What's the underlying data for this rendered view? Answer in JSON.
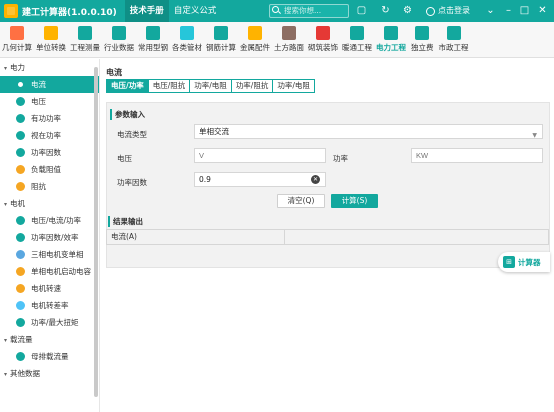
{
  "app": {
    "title": "建工计算器(1.0.0.10)"
  },
  "title_tabs": [
    {
      "label": "技术手册",
      "active": true
    },
    {
      "label": "自定义公式",
      "active": false
    }
  ],
  "search": {
    "placeholder": "搜索你想..."
  },
  "login": {
    "label": "点击登录"
  },
  "window_icons": [
    "dropdown-icon",
    "minimize-icon",
    "maximize-icon",
    "close-icon"
  ],
  "toolbar": {
    "items": [
      {
        "label": "几何计算",
        "color": "#ff7043"
      },
      {
        "label": "单位转换",
        "color": "#ffb300"
      },
      {
        "label": "工程测量",
        "color": "#13a89e"
      },
      {
        "label": "行业数据",
        "color": "#13a89e"
      },
      {
        "label": "常用型钢",
        "color": "#13a89e"
      },
      {
        "label": "各类管材",
        "color": "#26c6da"
      },
      {
        "label": "钢筋计算",
        "color": "#13a89e"
      },
      {
        "label": "金属配件",
        "color": "#ffb300"
      },
      {
        "label": "土方路面",
        "color": "#8d6e63"
      },
      {
        "label": "砌筑装饰",
        "color": "#e53935"
      },
      {
        "label": "暖通工程",
        "color": "#13a89e"
      },
      {
        "label": "电力工程",
        "color": "#13a89e",
        "active": true
      },
      {
        "label": "独立费",
        "color": "#13a89e"
      },
      {
        "label": "市政工程",
        "color": "#13a89e"
      }
    ]
  },
  "sidebar": {
    "groups": [
      {
        "label": "电力",
        "items": [
          {
            "label": "电流",
            "color": "#13a89e",
            "active": true
          },
          {
            "label": "电压",
            "color": "#13a89e"
          },
          {
            "label": "有功功率",
            "color": "#13a89e"
          },
          {
            "label": "视在功率",
            "color": "#13a89e"
          },
          {
            "label": "功率因数",
            "color": "#13a89e"
          },
          {
            "label": "负载阻值",
            "color": "#f5a623"
          },
          {
            "label": "阻抗",
            "color": "#f5a623"
          }
        ]
      },
      {
        "label": "电机",
        "items": [
          {
            "label": "电压/电流/功率",
            "color": "#13a89e"
          },
          {
            "label": "功率因数/效率",
            "color": "#13a89e"
          },
          {
            "label": "三相电机变单相",
            "color": "#5aa7e0"
          },
          {
            "label": "单相电机启动电容",
            "color": "#f5a623"
          },
          {
            "label": "电机转速",
            "color": "#f5a623"
          },
          {
            "label": "电机转差率",
            "color": "#4fc3f7"
          },
          {
            "label": "功率/最大扭矩",
            "color": "#13a89e"
          }
        ]
      },
      {
        "label": "载流量",
        "items": [
          {
            "label": "母排载流量",
            "color": "#13a89e"
          }
        ]
      },
      {
        "label": "其他数据",
        "items": []
      }
    ]
  },
  "main": {
    "section_title": "电流",
    "tabs": [
      {
        "label": "电压/功率",
        "active": true
      },
      {
        "label": "电压/阻抗"
      },
      {
        "label": "功率/电阻"
      },
      {
        "label": "功率/阻抗"
      },
      {
        "label": "功率/电阻"
      }
    ],
    "params": {
      "title": "参数输入",
      "current_type_label": "电流类型",
      "current_type_value": "单相交流",
      "voltage_label": "电压",
      "voltage_placeholder": "V",
      "power_label": "功率",
      "power_placeholder": "KW",
      "pf_label": "功率因数",
      "pf_value": "0.9",
      "clear_label": "清空(Q)",
      "calc_label": "计算(S)"
    },
    "result": {
      "title": "结果输出",
      "label": "电流(A)",
      "value": ""
    },
    "calc_badge": "计算器"
  }
}
